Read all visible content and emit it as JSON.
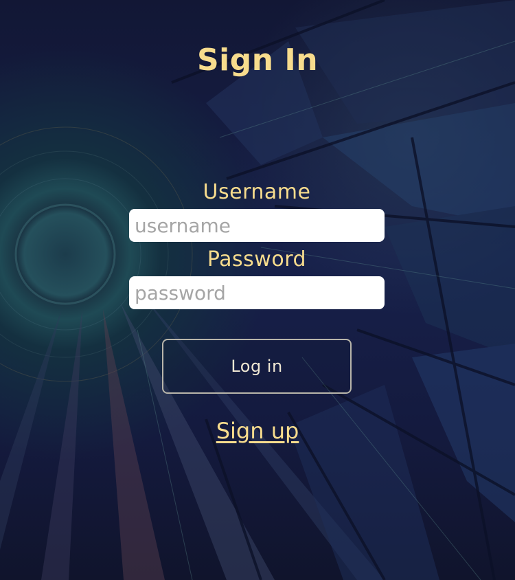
{
  "page": {
    "title": "Sign In"
  },
  "form": {
    "username_label": "Username",
    "username_placeholder": "username",
    "username_value": "",
    "password_label": "Password",
    "password_placeholder": "password",
    "password_value": ""
  },
  "actions": {
    "login_label": "Log in",
    "signup_label": "Sign up"
  },
  "colors": {
    "accent": "#f7dc8d",
    "background": "#141a38",
    "button_border": "#b9b6ab"
  }
}
